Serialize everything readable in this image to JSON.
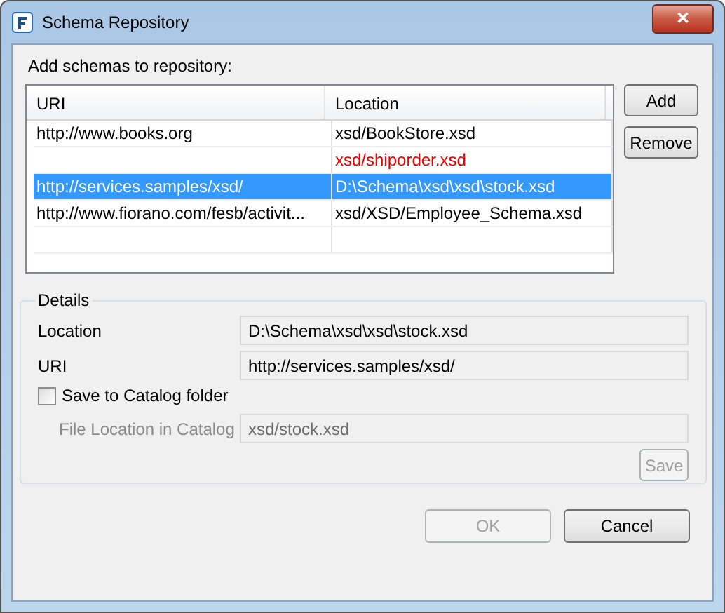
{
  "window": {
    "title": "Schema Repository",
    "close": "✕"
  },
  "table_label": "Add schemas to repository:",
  "table": {
    "columns": [
      "URI",
      "Location"
    ],
    "rows": [
      {
        "uri": "http://www.books.org",
        "location": "xsd/BookStore.xsd",
        "selected": false,
        "invalid": false
      },
      {
        "location": "xsd/shiporder.xsd",
        "selected": false,
        "invalid": true
      },
      {
        "uri": "http://services.samples/xsd/",
        "location": "D:\\Schema\\xsd\\xsd\\stock.xsd",
        "selected": true,
        "invalid": false
      },
      {
        "uri": "http://www.fiorano.com/fesb/activit...",
        "location": "xsd/XSD/Employee_Schema.xsd",
        "selected": false,
        "invalid": false
      }
    ]
  },
  "side_buttons": [
    {
      "label": "Add",
      "disabled": false
    },
    {
      "label": "Remove",
      "disabled": false
    }
  ],
  "details": {
    "title": "Details",
    "fields": [
      {
        "label": "Location",
        "value": "D:\\Schema\\xsd\\xsd\\stock.xsd",
        "disabled": false
      },
      {
        "label": "URI",
        "value": "http://services.samples/xsd/",
        "disabled": false
      }
    ],
    "checkbox": {
      "label": "Save to Catalog folder",
      "checked": false
    },
    "catalog_field": {
      "label": "File Location in Catalog",
      "value": "xsd/stock.xsd",
      "disabled": true
    },
    "save": {
      "label": "Save",
      "disabled": true
    }
  },
  "buttons": [
    {
      "label": "OK",
      "disabled": true
    },
    {
      "label": "Cancel",
      "disabled": false
    }
  ]
}
